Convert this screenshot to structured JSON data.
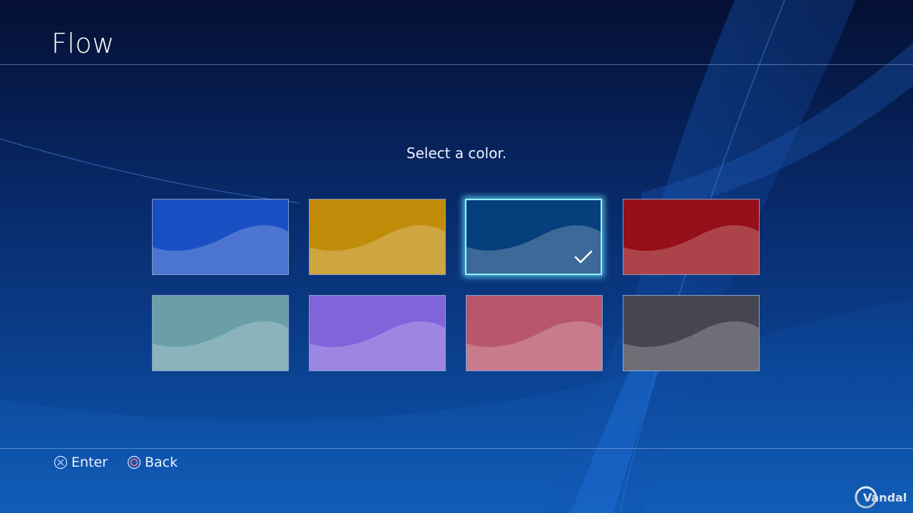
{
  "header": {
    "title": "Flow"
  },
  "prompt": "Select a color.",
  "colors": [
    {
      "id": "blue",
      "hex": "#1a4fc4",
      "selected": false
    },
    {
      "id": "gold",
      "hex": "#c08c0a",
      "selected": false
    },
    {
      "id": "dark-blue",
      "hex": "#073f7d",
      "selected": true
    },
    {
      "id": "red",
      "hex": "#950f18",
      "selected": false
    },
    {
      "id": "teal",
      "hex": "#6a9ea8",
      "selected": false
    },
    {
      "id": "purple",
      "hex": "#8064d9",
      "selected": false
    },
    {
      "id": "pink",
      "hex": "#b8566c",
      "selected": false
    },
    {
      "id": "gray",
      "hex": "#454650",
      "selected": false
    }
  ],
  "footer": {
    "enter_label": "Enter",
    "back_label": "Back",
    "enter_icon": "cross-button-icon",
    "back_icon": "circle-button-icon"
  },
  "watermark": {
    "text": "Vandal"
  },
  "theme": {
    "accent": "#8ef0ff",
    "text": "#ffffff"
  }
}
